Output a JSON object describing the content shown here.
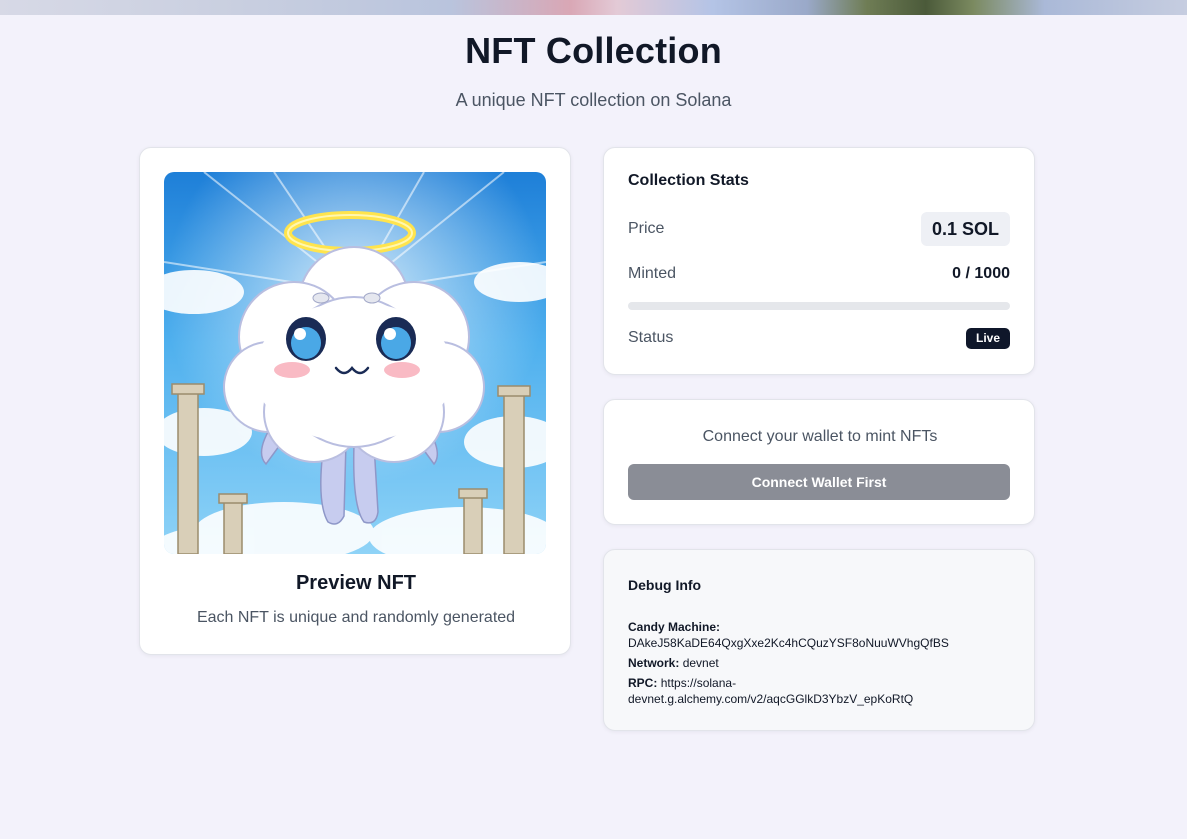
{
  "header": {
    "title": "NFT Collection",
    "subtitle": "A unique NFT collection on Solana"
  },
  "preview": {
    "title": "Preview NFT",
    "description": "Each NFT is unique and randomly generated",
    "image_alt": "cloud-angel-nft-artwork"
  },
  "stats": {
    "title": "Collection Stats",
    "price_label": "Price",
    "price_value": "0.1 SOL",
    "minted_label": "Minted",
    "minted_value": "0 / 1000",
    "minted_fraction": 0,
    "status_label": "Status",
    "status_value": "Live"
  },
  "wallet": {
    "message": "Connect your wallet to mint NFTs",
    "button_label": "Connect Wallet First"
  },
  "debug": {
    "title": "Debug Info",
    "candy_machine_label": "Candy Machine:",
    "candy_machine_value": "DAkeJ58KaDE64QxgXxe2Kc4hCQuzYSF8oNuuWVhgQfBS",
    "network_label": "Network:",
    "network_value": "devnet",
    "rpc_label": "RPC:",
    "rpc_value_line1": "https://solana-",
    "rpc_value_line2": "devnet.g.alchemy.com/v2/aqcGGlkD3YbzV_epKoRtQ"
  },
  "colors": {
    "background": "#f3f2fb",
    "badge": "#0f172a",
    "button_disabled": "#8a8d96"
  }
}
